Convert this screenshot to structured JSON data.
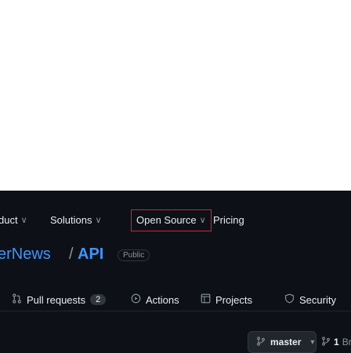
{
  "nav": {
    "items": [
      {
        "label": "duct",
        "chevron": "chevron-down-icon"
      },
      {
        "label": "Solutions",
        "chevron": "chevron-down-icon"
      },
      {
        "label": "Open Source",
        "chevron": "chevron-down-icon"
      },
      {
        "label": "Pricing"
      }
    ]
  },
  "repo": {
    "owner": "erNews",
    "separator": "/",
    "name": "API",
    "visibility": "Public"
  },
  "tabs": [
    {
      "label": "Pull requests",
      "count": "2",
      "icon": "pull-request-icon"
    },
    {
      "label": "Actions",
      "icon": "actions-icon"
    },
    {
      "label": "Projects",
      "icon": "projects-icon"
    },
    {
      "label": "Security",
      "icon": "shield-icon"
    }
  ],
  "branch": {
    "current": "master",
    "count": "1",
    "count_label": "Bran"
  },
  "colors": {
    "background": "#0d1117",
    "link": "#4493f8",
    "focus_outline": "#d1242f"
  }
}
